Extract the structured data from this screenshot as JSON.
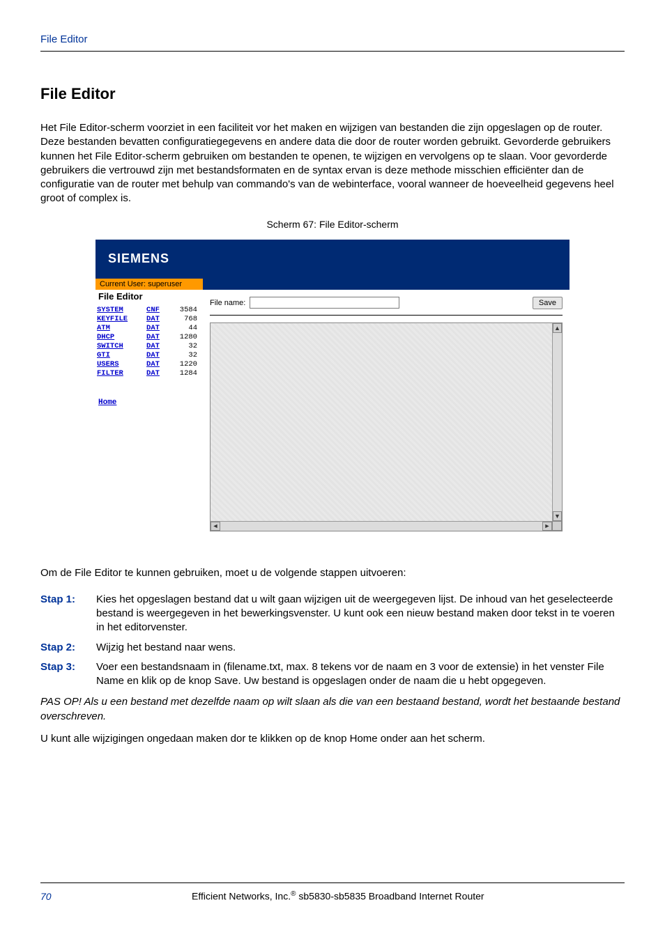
{
  "header": {
    "running_head": "File Editor"
  },
  "section": {
    "title": "File Editor",
    "intro": "Het File Editor-scherm voorziet in een faciliteit vor het maken en wijzigen van bestanden die zijn opgeslagen op de router. Deze bestanden bevatten configuratiegegevens en andere data die door de router worden gebruikt. Gevorderde gebruikers kunnen het File Editor-scherm gebruiken om bestanden te openen, te wijzigen en vervolgens op te slaan. Voor gevorderde gebruikers die vertrouwd zijn met bestandsformaten en de syntax ervan is deze methode misschien efficiënter dan de configuratie van de router met behulp van commando's van de webinterface, vooral wanneer de hoeveelheid gegevens heel groot of complex is.",
    "caption": "Scherm 67: File Editor-scherm"
  },
  "screenshot": {
    "logo_text": "SIEMENS",
    "current_user_label": "Current User: superuser",
    "sidebar_title": "File Editor",
    "files": [
      {
        "name": "SYSTEM",
        "ext": "CNF",
        "size": "3584"
      },
      {
        "name": "KEYFILE",
        "ext": "DAT",
        "size": "768"
      },
      {
        "name": "ATM",
        "ext": "DAT",
        "size": "44"
      },
      {
        "name": "DHCP",
        "ext": "DAT",
        "size": "1280"
      },
      {
        "name": "SWITCH",
        "ext": "DAT",
        "size": "32"
      },
      {
        "name": "GTI",
        "ext": "DAT",
        "size": "32"
      },
      {
        "name": "USERS",
        "ext": "DAT",
        "size": "1220"
      },
      {
        "name": "FILTER",
        "ext": "DAT",
        "size": "1284"
      }
    ],
    "home_link": "Home",
    "filename_label": "File name:",
    "filename_value": "",
    "save_label": "Save"
  },
  "after_shot": {
    "lead_in": "Om de File Editor te kunnen gebruiken, moet u de volgende stappen uitvoeren:",
    "steps": [
      {
        "label": "Stap 1:",
        "text": "Kies het opgeslagen bestand dat u wilt gaan wijzigen uit de weergegeven lijst. De inhoud van het geselecteerde bestand is weergegeven in het bewerkingsvenster. U kunt ook een nieuw bestand maken door tekst in te voeren in het editorvenster."
      },
      {
        "label": "Stap 2:",
        "text": "Wijzig het bestand naar wens."
      },
      {
        "label": "Stap 3:",
        "text": "Voer een bestandsnaam in (filename.txt, max. 8 tekens vor de naam en 3 voor de extensie) in het venster File Name en klik op de knop Save. Uw bestand is opgeslagen onder de naam die u hebt opgegeven."
      }
    ],
    "note": "PAS OP! Als u een bestand met dezelfde naam op wilt slaan als die van een bestaand bestand, wordt het bestaande bestand overschreven.",
    "closing": "U  kunt alle wijzigingen ongedaan maken dor te klikken op de knop Home onder aan het scherm."
  },
  "footer": {
    "page_number": "70",
    "company_prefix": "Efficient Networks, Inc.",
    "product": " sb5830-sb5835 Broadband Internet Router"
  }
}
